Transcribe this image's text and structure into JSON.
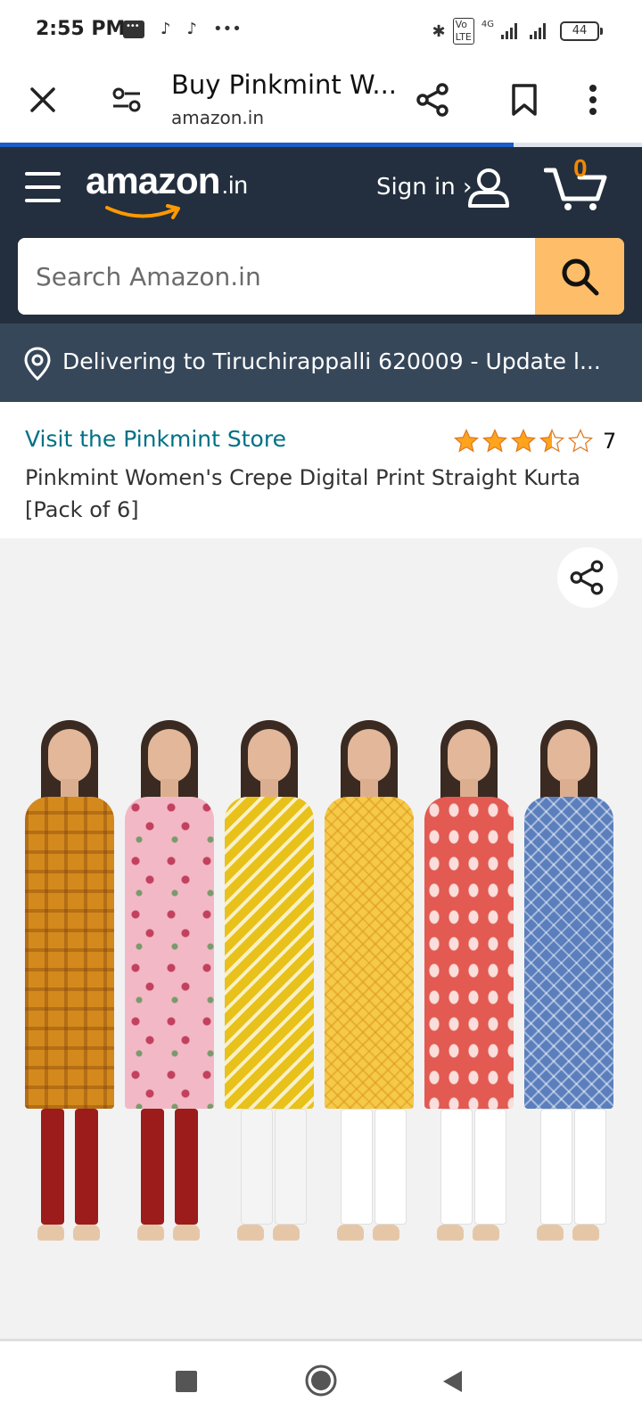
{
  "status_bar": {
    "time": "2:55 PM",
    "battery": "44",
    "network": "4G",
    "icons": [
      "message-icon",
      "app-icon",
      "app-icon",
      "more-dots-icon",
      "bluetooth-icon",
      "volte-icon",
      "signal-icon",
      "signal-icon",
      "battery-icon"
    ]
  },
  "browser": {
    "title": "Buy Pinkmint W...",
    "url": "amazon.in",
    "load_progress_percent": 80
  },
  "amazon_header": {
    "logo_word": "amazon",
    "logo_tld": ".in",
    "signin_label": "Sign in ›",
    "cart_count": "0",
    "search_placeholder": "Search Amazon.in",
    "delivery_text": "Delivering to Tiruchirappalli 620009 - Update l..."
  },
  "product": {
    "store_link": "Visit the Pinkmint Store",
    "rating_stars": 3.5,
    "rating_count": "7",
    "title": "Pinkmint Women's Crepe Digital Print Straight Kurta [Pack of 6]"
  },
  "image": {
    "alt": "Pinkmint kurta pack",
    "kurtas": [
      {
        "color": "#d4891c",
        "pattern": "mustard-print",
        "bottom": "#9c1b1b"
      },
      {
        "color": "#f2b8c6",
        "pattern": "floral",
        "bottom": "#9c1b1b"
      },
      {
        "color": "#e8c21a",
        "pattern": "chevron",
        "bottom": "#f4f4f4"
      },
      {
        "color": "#f5c94a",
        "pattern": "lattice",
        "bottom": "#ffffff"
      },
      {
        "color": "#e25a52",
        "pattern": "ikat",
        "bottom": "#ffffff"
      },
      {
        "color": "#5b7fbd",
        "pattern": "geometric",
        "bottom": "#ffffff"
      }
    ]
  },
  "colors": {
    "amazon_dark": "#232f3e",
    "delivery_bar": "#37475a",
    "search_button": "#febd69",
    "link": "#007185",
    "star": "#ffa41c",
    "cart_count": "#f08804",
    "progress": "#1a5cc8"
  }
}
